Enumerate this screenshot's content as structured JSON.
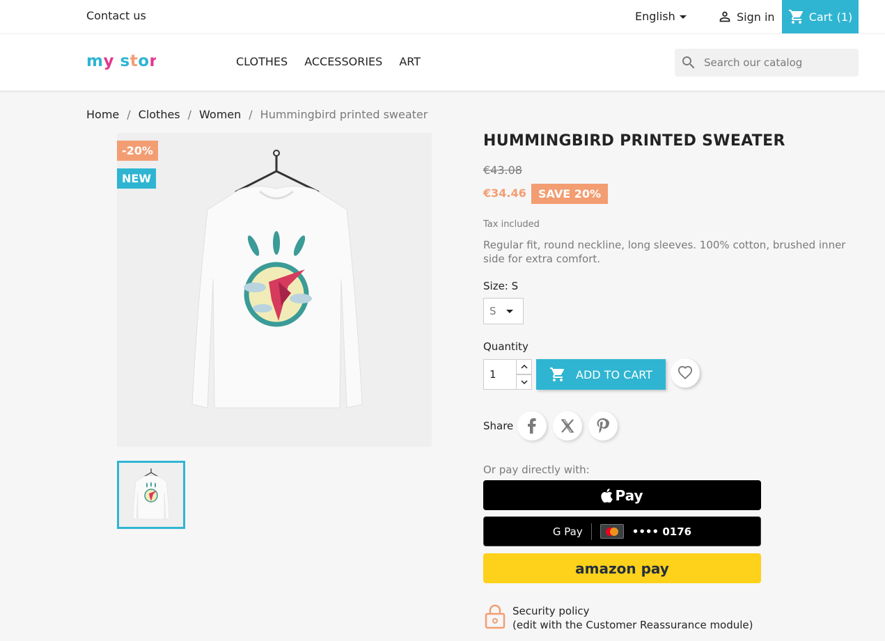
{
  "topbar": {
    "contact": "Contact us",
    "language": "English",
    "signin": "Sign in",
    "cart_label": "Cart",
    "cart_count": "(1)"
  },
  "header": {
    "logo_text": "my store",
    "nav": [
      "CLOTHES",
      "ACCESSORIES",
      "ART"
    ],
    "search_placeholder": "Search our catalog"
  },
  "breadcrumb": {
    "items": [
      "Home",
      "Clothes",
      "Women"
    ],
    "current": "Hummingbird printed sweater"
  },
  "product": {
    "discount_badge": "-20%",
    "new_badge": "NEW",
    "title": "HUMMINGBIRD PRINTED SWEATER",
    "old_price": "€43.08",
    "price": "€34.46",
    "save_label": "SAVE 20%",
    "tax": "Tax included",
    "description": "Regular fit, round neckline, long sleeves. 100% cotton, brushed inner side for extra comfort.",
    "size_label": "Size: S",
    "size_value": "S",
    "quantity_label": "Quantity",
    "quantity_value": "1",
    "add_to_cart": "ADD TO CART"
  },
  "share": {
    "label": "Share"
  },
  "payment": {
    "label": "Or pay directly with:",
    "apple_pay": "Pay",
    "google_pay": "G Pay",
    "card_number": "•••• 0176",
    "amazon_pay": "amazon pay"
  },
  "reassurance": {
    "title": "Security policy",
    "subtitle": "(edit with the Customer Reassurance module)"
  },
  "colors": {
    "accent": "#2fb5d2",
    "discount": "#f39d72",
    "amazon": "#fed11a"
  }
}
